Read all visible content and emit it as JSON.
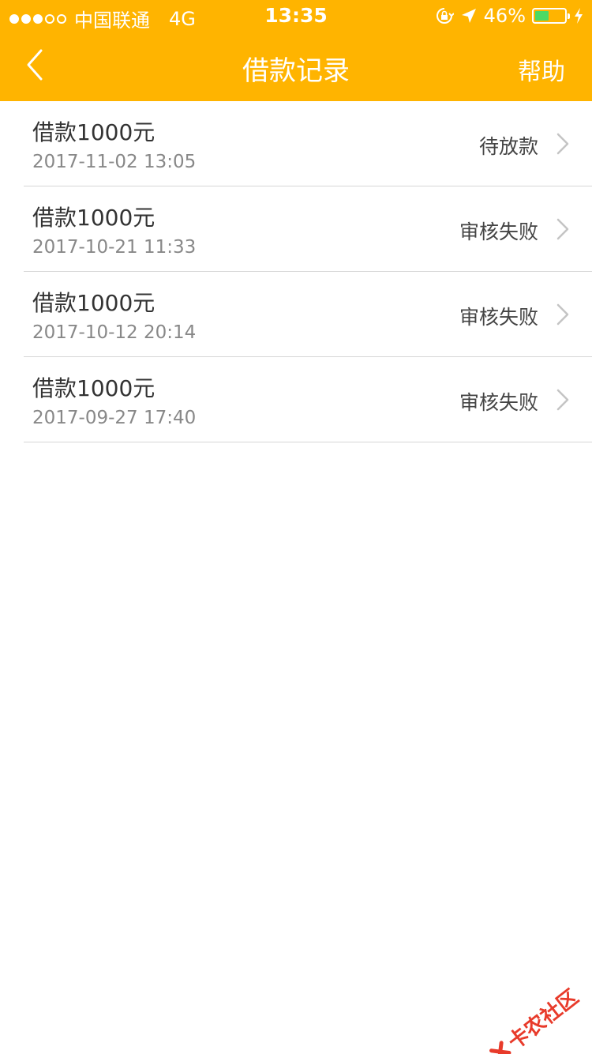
{
  "status_bar": {
    "carrier": "中国联通",
    "network": "4G",
    "time": "13:35",
    "battery": "46%",
    "battery_level": 0.46
  },
  "nav": {
    "title": "借款记录",
    "help": "帮助"
  },
  "records": [
    {
      "title": "借款1000元",
      "date": "2017-11-02 13:05",
      "status": "待放款"
    },
    {
      "title": "借款1000元",
      "date": "2017-10-21 11:33",
      "status": "审核失败"
    },
    {
      "title": "借款1000元",
      "date": "2017-10-12 20:14",
      "status": "审核失败"
    },
    {
      "title": "借款1000元",
      "date": "2017-09-27 17:40",
      "status": "审核失败"
    }
  ],
  "watermark": "卡农社区",
  "colors": {
    "header": "#FFB400",
    "battery_fill": "#4CD964",
    "watermark": "#E83B2B"
  },
  "icons": [
    "back-chevron-icon",
    "chevron-right-icon",
    "lock-rotation-icon",
    "location-arrow-icon",
    "charging-bolt-icon"
  ]
}
